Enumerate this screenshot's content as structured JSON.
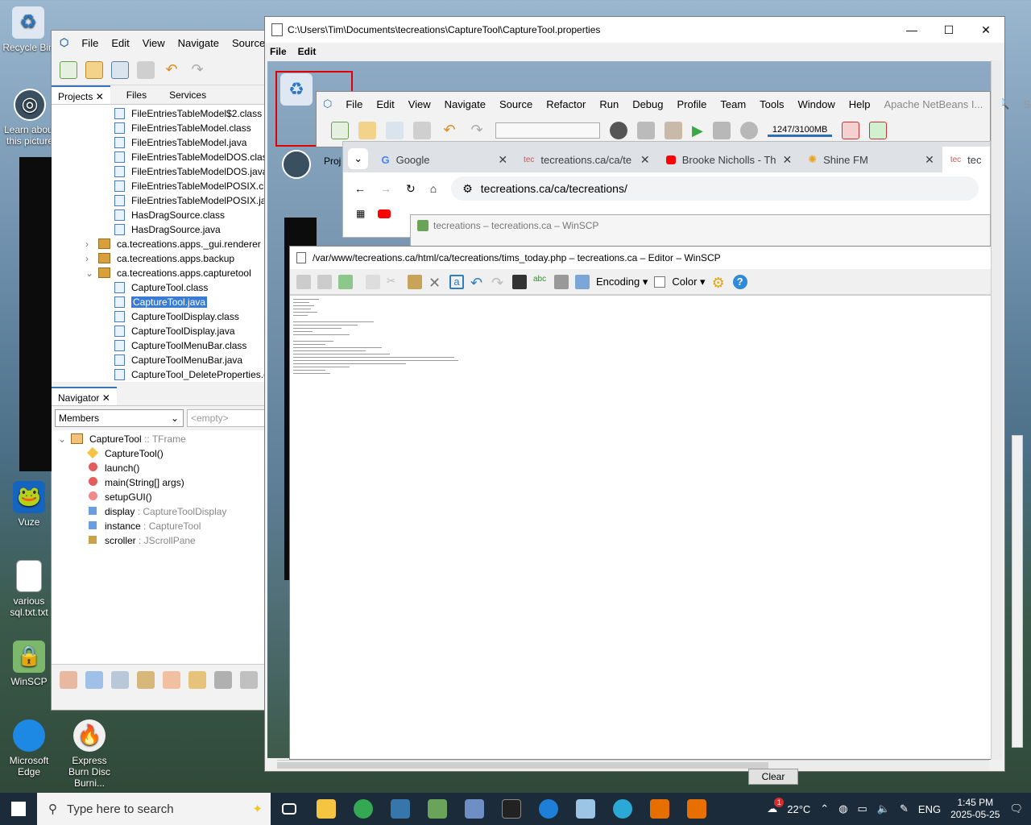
{
  "desktop_icons": {
    "recycle_bin": "Recycle Bin",
    "learn": "Learn about this picture",
    "vuze": "Vuze",
    "various_sql": "various sql.txt.txt",
    "winscp": "WinSCP",
    "edge": "Microsoft Edge",
    "express_burn": "Express Burn Disc Burni..."
  },
  "netbeans": {
    "menu": [
      "File",
      "Edit",
      "View",
      "Navigate",
      "Source"
    ],
    "tabs": [
      "Projects",
      "Files",
      "Services"
    ],
    "tree": [
      {
        "label": "FileEntriesTableModel$2.class",
        "kind": "file"
      },
      {
        "label": "FileEntriesTableModel.class",
        "kind": "file"
      },
      {
        "label": "FileEntriesTableModel.java",
        "kind": "file"
      },
      {
        "label": "FileEntriesTableModelDOS.class",
        "kind": "file"
      },
      {
        "label": "FileEntriesTableModelDOS.java",
        "kind": "file"
      },
      {
        "label": "FileEntriesTableModelPOSIX.class",
        "kind": "file"
      },
      {
        "label": "FileEntriesTableModelPOSIX.java",
        "kind": "file"
      },
      {
        "label": "HasDragSource.class",
        "kind": "file"
      },
      {
        "label": "HasDragSource.java",
        "kind": "file"
      },
      {
        "label": "ca.tecreations.apps._gui.renderer",
        "kind": "package"
      },
      {
        "label": "ca.tecreations.apps.backup",
        "kind": "package"
      },
      {
        "label": "ca.tecreations.apps.capturetool",
        "kind": "package"
      },
      {
        "label": "CaptureTool.class",
        "kind": "file"
      },
      {
        "label": "CaptureTool.java",
        "kind": "file",
        "selected": true
      },
      {
        "label": "CaptureToolDisplay.class",
        "kind": "file"
      },
      {
        "label": "CaptureToolDisplay.java",
        "kind": "file"
      },
      {
        "label": "CaptureToolMenuBar.class",
        "kind": "file"
      },
      {
        "label": "CaptureToolMenuBar.java",
        "kind": "file"
      },
      {
        "label": "CaptureTool_DeleteProperties.c",
        "kind": "file"
      }
    ],
    "navigator_tab": "Navigator",
    "members_select": "Members",
    "empty_filter": "<empty>",
    "nav_class": "CaptureTool",
    "nav_class_type": ":: TFrame",
    "members": [
      {
        "name": "CaptureTool()",
        "type": ""
      },
      {
        "name": "launch()",
        "type": ""
      },
      {
        "name": "main(String[] args)",
        "type": ""
      },
      {
        "name": "setupGUI()",
        "type": ""
      },
      {
        "name": "display",
        "type": ": CaptureToolDisplay"
      },
      {
        "name": "instance",
        "type": ": CaptureTool"
      },
      {
        "name": "scroller",
        "type": ": JScrollPane"
      }
    ]
  },
  "text_editor": {
    "title": "C:\\Users\\Tim\\Documents\\tecreations\\CaptureTool\\CaptureTool.properties",
    "menu": [
      "File",
      "Edit"
    ]
  },
  "netbeans_inner": {
    "menu": [
      "File",
      "Edit",
      "View",
      "Navigate",
      "Source",
      "Refactor",
      "Run",
      "Debug",
      "Profile",
      "Team",
      "Tools",
      "Window",
      "Help"
    ],
    "product": "Apache NetBeans I...",
    "search": "Search",
    "memory": "1247/3100MB",
    "proj_tab": "Proj"
  },
  "chrome": {
    "tabs": [
      "Google",
      "tecreations.ca/ca/te",
      "Brooke Nicholls - Th",
      "Shine FM",
      "tec"
    ],
    "url": "tecreations.ca/ca/tecreations/"
  },
  "winscp": {
    "session_title": "tecreations – tecreations.ca – WinSCP",
    "editor_title": "/var/www/tecreations.ca/html/ca/tecreations/tims_today.php – tecreations.ca – Editor – WinSCP",
    "encoding": "Encoding",
    "color": "Color"
  },
  "clear_button": "Clear",
  "taskbar": {
    "search_placeholder": "Type here to search",
    "temperature": "22°C",
    "language": "ENG",
    "time": "1:45 PM",
    "date": "2025-05-25",
    "weather_badge": "1"
  }
}
